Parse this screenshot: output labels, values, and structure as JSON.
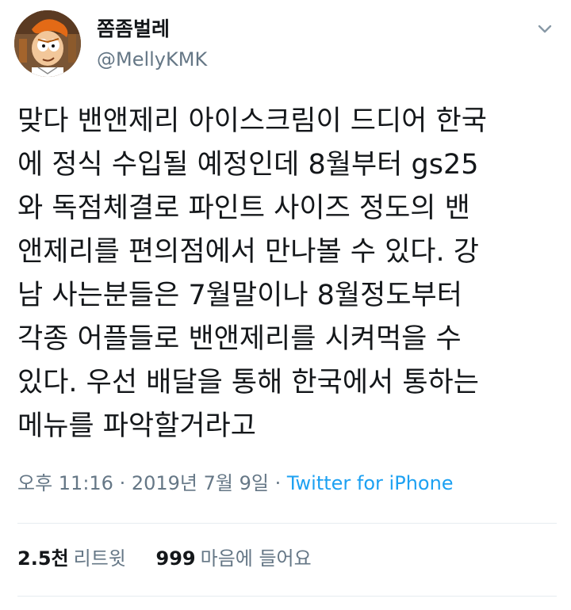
{
  "author": {
    "display_name": "쫌좀벌레",
    "handle": "@MellyKMK"
  },
  "tweet": {
    "lines": [
      "맞다 밴앤제리 아이스크림이 드디어 한국",
      "에 정식 수입될 예정인데 8월부터 gs25",
      "와 독점체결로 파인트 사이즈 정도의 밴",
      "앤제리를 편의점에서 만나볼 수 있다. 강",
      "남 사는분들은 7월말이나 8월정도부터",
      "각종 어플들로 밴앤제리를 시켜먹을 수",
      "있다. 우선 배달을 통해 한국에서 통하는",
      "메뉴를 파악할거라고"
    ]
  },
  "meta": {
    "time": "오후 11:16",
    "separator": " · ",
    "date": "2019년 7월 9일",
    "source": "Twitter for iPhone"
  },
  "stats": {
    "retweets": {
      "count": "2.5천",
      "label": "리트윗"
    },
    "likes": {
      "count": "999",
      "label": "마음에 들어요"
    }
  },
  "icons": {
    "menu": "chevron-down-icon",
    "avatar": "cartoon-avatar"
  },
  "colors": {
    "text": "#14171a",
    "secondary": "#657786",
    "link": "#1da1f2",
    "divider": "#e6ecf0"
  }
}
